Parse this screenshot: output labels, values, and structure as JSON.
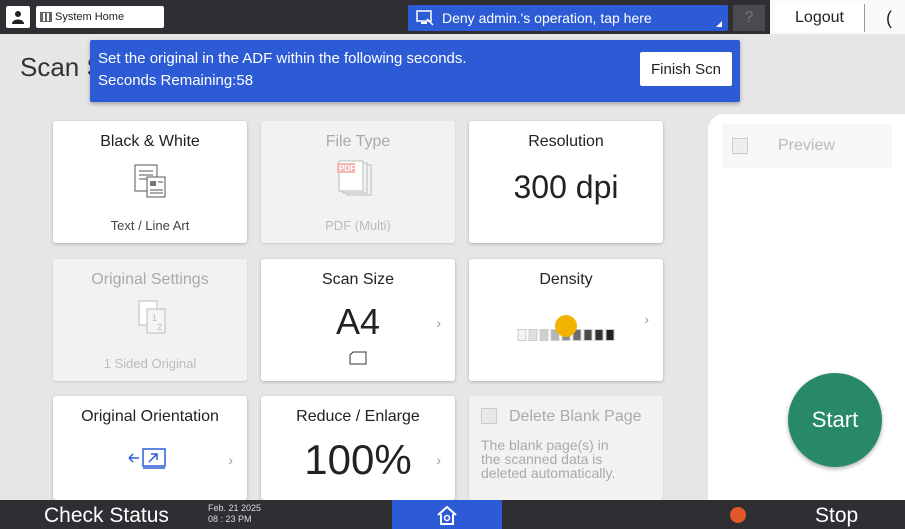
{
  "topbar": {
    "system_home_label": "System Home",
    "deny_label": "Deny admin.'s operation, tap here",
    "help_label": "?",
    "logout_label": "Logout",
    "moon_label": "(",
    "icons": [
      "user-icon",
      "grid-icon",
      "remote-icon",
      "moon-icon"
    ]
  },
  "page_title": "Scan S",
  "notice": {
    "message": "Set the original in the ADF within the following seconds.",
    "seconds": "Seconds Remaining:58",
    "finish_label": "Finish Scn"
  },
  "tiles": {
    "color": {
      "title": "Black & White",
      "sub": "Text / Line Art"
    },
    "file_type": {
      "title": "File Type",
      "sub": "PDF (Multi)",
      "badge": "PDF"
    },
    "resolution": {
      "title": "Resolution",
      "value": "300 dpi"
    },
    "original_settings": {
      "title": "Original Settings",
      "sub": "1 Sided Original"
    },
    "scan_size": {
      "title": "Scan Size",
      "value": "A4"
    },
    "density": {
      "title": "Density",
      "level": 5,
      "steps": 9
    },
    "orientation": {
      "title": "Original Orientation"
    },
    "reduce_enlarge": {
      "title": "Reduce / Enlarge",
      "value": "100%"
    },
    "delete_blank": {
      "title": "Delete Blank Page",
      "desc": "The blank page(s) in the scanned data is deleted automatically."
    }
  },
  "preview": {
    "label": "Preview"
  },
  "start": {
    "label": "Start"
  },
  "bottombar": {
    "check_status": "Check Status",
    "date": "Feb. 21 2025",
    "time": "08 : 23 PM",
    "stop_label": "Stop"
  },
  "colors": {
    "accent_blue": "#2d5bd6",
    "start_green": "#27886a",
    "stop_orange": "#e3582a",
    "knob_yellow": "#f2b400"
  }
}
